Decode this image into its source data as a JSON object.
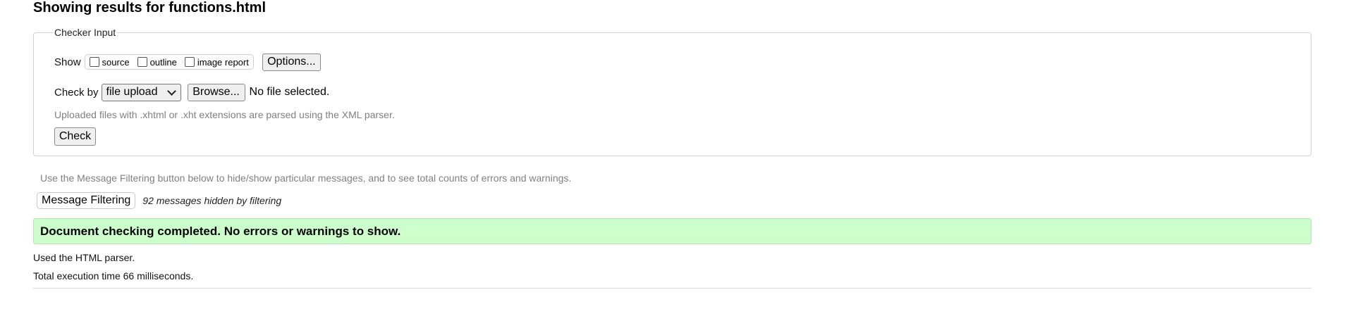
{
  "page": {
    "title": "Showing results for functions.html"
  },
  "checker_input": {
    "legend": "Checker Input",
    "show_label": "Show",
    "show_options": [
      {
        "label": "source",
        "checked": false
      },
      {
        "label": "outline",
        "checked": false
      },
      {
        "label": "image report",
        "checked": false
      }
    ],
    "options_button": "Options...",
    "check_by_label": "Check by",
    "check_by_select": {
      "selected": "file upload"
    },
    "browse_button": "Browse...",
    "file_status": "No file selected.",
    "upload_hint": "Uploaded files with .xhtml or .xht extensions are parsed using the XML parser.",
    "check_button": "Check"
  },
  "filtering": {
    "hint": "Use the Message Filtering button below to hide/show particular messages, and to see total counts of errors and warnings.",
    "button": "Message Filtering",
    "hidden_count": "92 messages hidden by filtering"
  },
  "result": {
    "status": "Document checking completed. No errors or warnings to show.",
    "status_color": "#ccffcc",
    "parser_info": "Used the HTML parser.",
    "execution_time": "Total execution time 66 milliseconds."
  }
}
